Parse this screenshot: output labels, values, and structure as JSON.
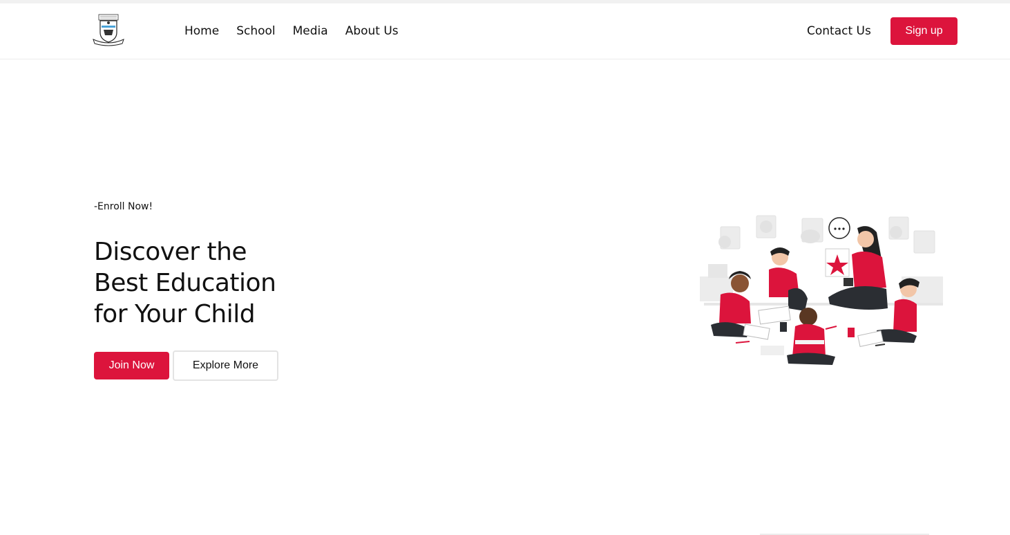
{
  "nav": {
    "logo_alt": "school-crest",
    "links": [
      "Home",
      "School",
      "Media",
      "About Us"
    ],
    "contact_label": "Contact Us",
    "signup_label": "Sign up"
  },
  "hero": {
    "eyebrow": "-Enroll Now!",
    "headline_lines": [
      "Discover the",
      "Best Education",
      "for Your Child"
    ],
    "join_label": "Join Now",
    "explore_label": "Explore More"
  },
  "colors": {
    "accent": "#dc143c",
    "text": "#111111",
    "background": "#ffffff"
  },
  "icons": {
    "logo": "school-crest-icon",
    "illustration": "teacher-with-children-illustration"
  }
}
